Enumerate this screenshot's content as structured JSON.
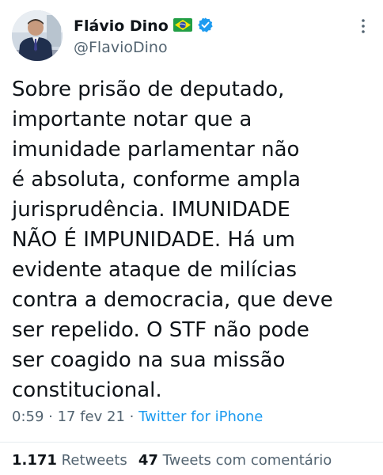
{
  "author": {
    "display_name": "Flávio Dino",
    "handle": "@FlavioDino",
    "flag_icon": "brazil-flag-icon",
    "verified_icon": "verified-badge-icon",
    "verified_color": "#1d9bf0"
  },
  "tweet": {
    "lines": [
      "Sobre prisão de deputado,",
      "importante notar que a",
      "imunidade parlamentar não",
      "é absoluta, conforme ampla",
      "jurisprudência. IMUNIDADE",
      "NÃO É IMPUNIDADE. Há um",
      "evidente ataque de milícias",
      "contra a democracia, que deve",
      "ser repelido. O STF não pode",
      "ser coagido na sua missão",
      "constitucional."
    ]
  },
  "meta": {
    "time": "0:59",
    "separator": " · ",
    "date": "17 fev 21",
    "source": "Twitter for iPhone"
  },
  "stats": {
    "retweets_count": "1.171",
    "retweets_label": "Retweets",
    "quotes_count": "47",
    "quotes_label": "Tweets com comentário"
  },
  "colors": {
    "text": "#0f1419",
    "secondary": "#536471",
    "link": "#1d9bf0"
  },
  "icons": {
    "more": "more-vertical-icon",
    "avatar": "avatar"
  }
}
